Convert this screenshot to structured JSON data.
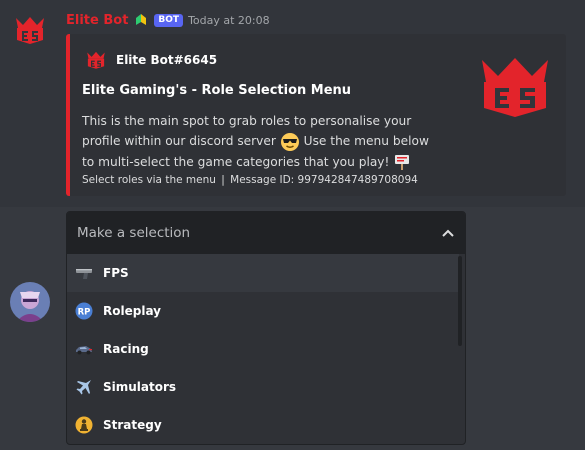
{
  "message": {
    "username": "Elite Bot",
    "bot_tag": "BOT",
    "timestamp": "Today at 20:08"
  },
  "embed": {
    "author": "Elite Bot#6645",
    "title": "Elite Gaming's - Role Selection Menu",
    "description_part1": "This is the main spot to grab roles to personalise your profile within our discord server",
    "description_part2": "Use the menu below to multi-select the game categories that you play!",
    "footer_text": "Select roles via the menu",
    "footer_separator": "|",
    "footer_message_id": "Message ID: 997942847489708094",
    "accent_color": "#e3242b"
  },
  "select_menu": {
    "placeholder": "Make a selection",
    "options": [
      {
        "label": "FPS",
        "icon": "pistol-icon"
      },
      {
        "label": "Roleplay",
        "icon": "rp-badge-icon"
      },
      {
        "label": "Racing",
        "icon": "race-car-icon"
      },
      {
        "label": "Simulators",
        "icon": "airplane-icon"
      },
      {
        "label": "Strategy",
        "icon": "chess-pawn-icon"
      }
    ]
  }
}
